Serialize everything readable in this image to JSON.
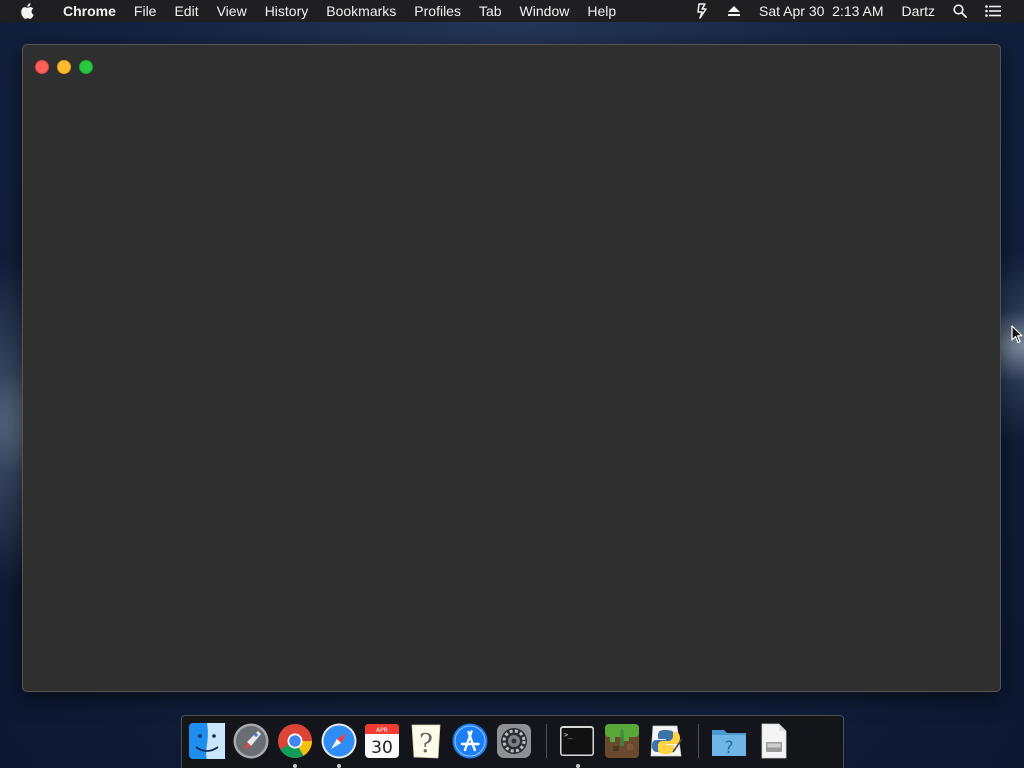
{
  "menubar": {
    "apple_icon": "apple-logo",
    "app_name": "Chrome",
    "items": [
      "File",
      "Edit",
      "View",
      "History",
      "Bookmarks",
      "Profiles",
      "Tab",
      "Window",
      "Help"
    ],
    "status": {
      "datetime": "Sat Apr 30  2:13 AM",
      "user": "Dartz",
      "icons": [
        "script-icon",
        "eject-icon",
        "spotlight-icon",
        "notification-center-icon"
      ]
    }
  },
  "window": {
    "app": "Chrome",
    "controls": [
      "close",
      "minimize",
      "zoom"
    ],
    "colors": {
      "close": "#fe5f57",
      "minimize": "#febc2e",
      "zoom": "#28c840",
      "background": "#2f2f2f"
    }
  },
  "dock": {
    "apps": [
      {
        "name": "Finder",
        "icon": "finder-icon",
        "running": false
      },
      {
        "name": "Launchpad",
        "icon": "launchpad-icon",
        "running": false
      },
      {
        "name": "Google Chrome",
        "icon": "chrome-icon",
        "running": true
      },
      {
        "name": "Safari",
        "icon": "safari-icon",
        "running": true
      },
      {
        "name": "Calendar",
        "icon": "calendar-icon",
        "running": false,
        "month": "APR",
        "day": "30"
      },
      {
        "name": "Notes",
        "icon": "notes-icon",
        "running": false
      },
      {
        "name": "App Store",
        "icon": "app-store-icon",
        "running": false
      },
      {
        "name": "System Preferences",
        "icon": "system-preferences-icon",
        "running": false
      },
      {
        "name": "Terminal",
        "icon": "terminal-icon",
        "running": true,
        "glyph": ">_"
      },
      {
        "name": "Minecraft",
        "icon": "minecraft-icon",
        "running": false
      },
      {
        "name": "Python Launcher",
        "icon": "python-icon",
        "running": false
      },
      {
        "name": "Folder",
        "icon": "folder-icon",
        "running": false
      },
      {
        "name": "Document",
        "icon": "document-icon",
        "running": false
      }
    ]
  }
}
